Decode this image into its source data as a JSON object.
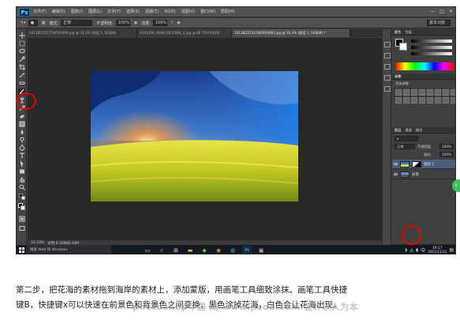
{
  "app": {
    "logo": "Ps",
    "menu": [
      "文件(F)",
      "编辑(E)",
      "图像(I)",
      "图层(L)",
      "文字(Y)",
      "选择(S)",
      "滤镜(T)",
      "3D(D)",
      "视图(V)",
      "窗口(W)",
      "帮助(H)"
    ]
  },
  "options_bar": {
    "mode_label": "模式:",
    "mode_value": "正常",
    "opacity_label": "不透明度:",
    "opacity_value": "100%",
    "flow_label": "流量:",
    "flow_value": "100%",
    "workspace": "基本功能"
  },
  "tabs": [
    {
      "label": "201382215174659(009.jpg @ 33.3% (图层 1, RGB/8)",
      "active": false
    },
    {
      "label": "4342496_094618031084_2.jpg @ 66.7%(RGB/8)",
      "active": false
    },
    {
      "label": "201382215174659(006).jpg @ 33.3% (图层 1, RGB/8) *",
      "active": true
    }
  ],
  "status": {
    "zoom": "33.33%",
    "doc": "文档:6.32M/8.43M"
  },
  "panels": {
    "color_tabs": [
      "颜色",
      "色板"
    ],
    "swatches_tab": "调整",
    "swatches_sub": "添加调整",
    "layers_tabs": [
      "图层",
      "通道",
      "路径"
    ],
    "blend_mode": "正常",
    "opacity_label": "不透明度:",
    "opacity_value": "100%",
    "fill_label": "填充:",
    "fill_value": "100%",
    "layers": [
      {
        "name": "图层 1",
        "active": true
      },
      {
        "name": "背景",
        "active": false
      }
    ]
  },
  "taskbar": {
    "search_placeholder": "搜索 Web 和 Windows",
    "time": "19:17",
    "date": "2015/11/12"
  },
  "caption": {
    "line1": "第二步，把花海的素材拖到海岸的素材上，添加蒙版，用画笔工具细致涂抹。画笔工具快捷",
    "line2": "键B，快捷键x可以快速在前景色和背景色之间变换，黑色涂掉花海，白色会让花海出现。"
  },
  "watermark": "photoshop中国 网 www.pcoo.com 设计以人为本",
  "colors": {
    "highlight": "#e60000",
    "active_layer": "#4b5f7c"
  }
}
